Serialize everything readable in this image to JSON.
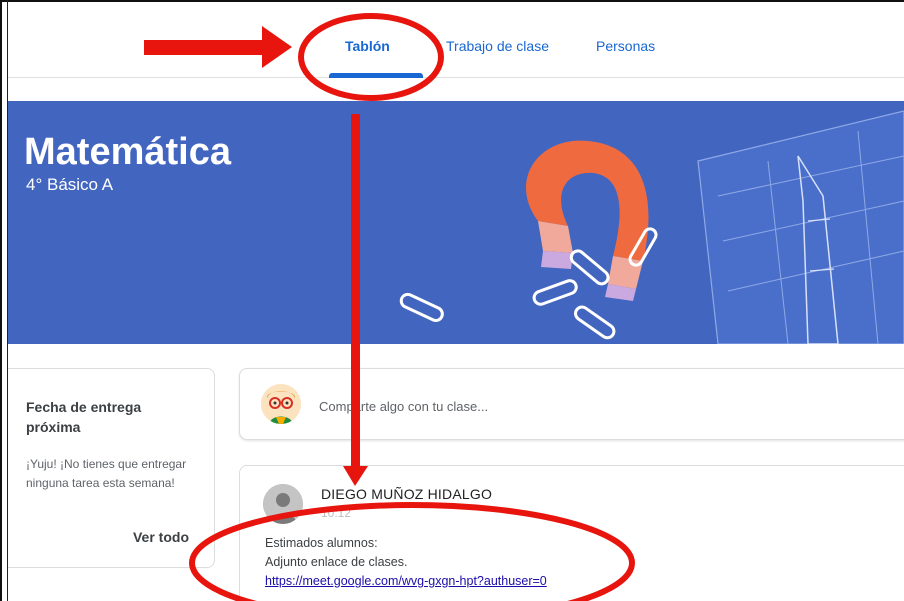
{
  "nav": {
    "tabs": [
      {
        "label": "Tablón"
      },
      {
        "label": "Trabajo de clase"
      },
      {
        "label": "Personas"
      }
    ]
  },
  "banner": {
    "title": "Matemática",
    "subtitle": "4° Básico A"
  },
  "upcoming": {
    "title": "Fecha de entrega próxima",
    "text": "¡Yuju! ¡No tienes que entregar ninguna tarea esta semana!",
    "link": "Ver todo"
  },
  "share": {
    "placeholder": "Comparte algo con tu clase..."
  },
  "post": {
    "author": "DIEGO MUÑOZ HIDALGO",
    "time": "10:12",
    "lines": [
      "Estimados alumnos:",
      "Adjunto enlace de clases."
    ],
    "link": "https://meet.google.com/wvg-gxgn-hpt?authuser=0"
  },
  "colors": {
    "accent": "#1967d2",
    "banner": "#4265c0",
    "annotation": "#e8150f"
  }
}
